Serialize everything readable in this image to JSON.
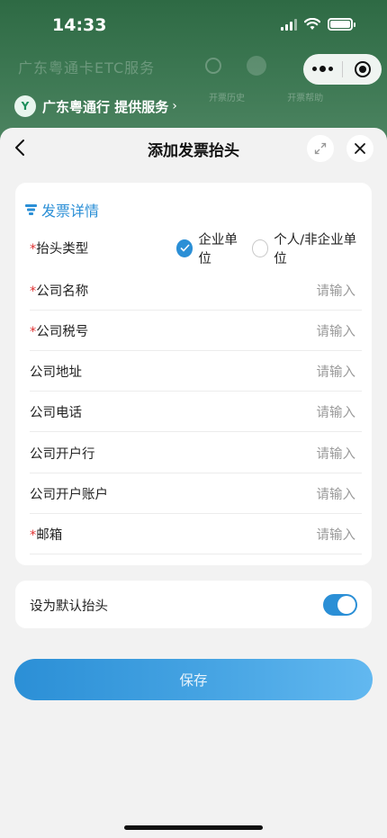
{
  "status_bar": {
    "time": "14:33"
  },
  "background": {
    "title": "广东粤通卡ETC服务",
    "tabs": [
      "开票历史",
      "开票帮助"
    ]
  },
  "provider": {
    "logo": "Y",
    "text": "广东粤通行 提供服务",
    "arrow": "›"
  },
  "sheet": {
    "title": "添加发票抬头"
  },
  "details": {
    "section_title": "发票详情",
    "header_type": {
      "label": "抬头类型",
      "required": true,
      "options": [
        {
          "label": "企业单位",
          "selected": true
        },
        {
          "label": "个人/非企业单位",
          "selected": false
        }
      ]
    },
    "fields": [
      {
        "label": "公司名称",
        "required": true,
        "placeholder": "请输入"
      },
      {
        "label": "公司税号",
        "required": true,
        "placeholder": "请输入"
      },
      {
        "label": "公司地址",
        "required": false,
        "placeholder": "请输入"
      },
      {
        "label": "公司电话",
        "required": false,
        "placeholder": "请输入"
      },
      {
        "label": "公司开户行",
        "required": false,
        "placeholder": "请输入"
      },
      {
        "label": "公司开户账户",
        "required": false,
        "placeholder": "请输入"
      },
      {
        "label": "邮箱",
        "required": true,
        "placeholder": "请输入"
      }
    ]
  },
  "default_setting": {
    "label": "设为默认抬头",
    "enabled": true
  },
  "save_button": {
    "label": "保存"
  },
  "required_mark": "*",
  "colors": {
    "accent": "#2b8fd6",
    "required": "#e03030",
    "header_bg": "#2e6a44"
  }
}
